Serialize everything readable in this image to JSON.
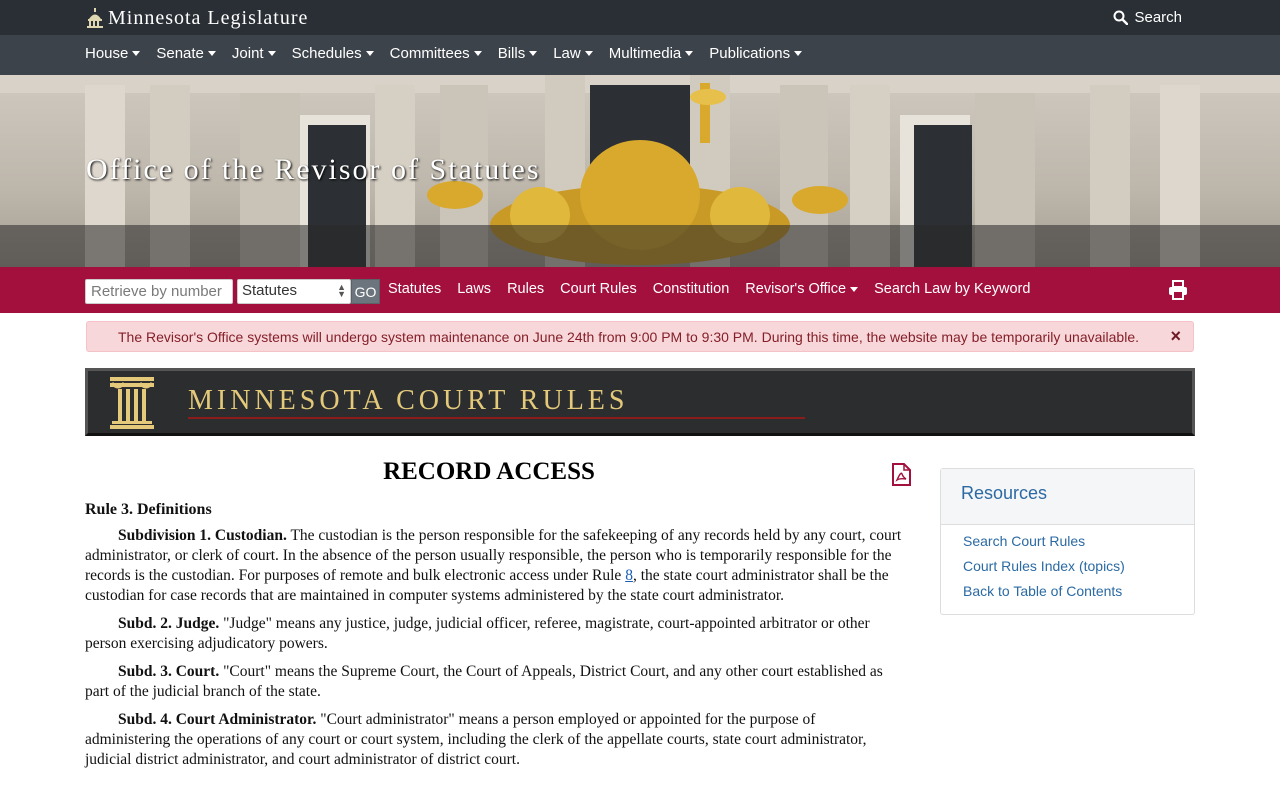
{
  "topbar": {
    "brand": "Minnesota Legislature",
    "search_label": "Search"
  },
  "mainnav": {
    "items": [
      "House",
      "Senate",
      "Joint",
      "Schedules",
      "Committees",
      "Bills",
      "Law",
      "Multimedia",
      "Publications"
    ]
  },
  "hero": {
    "title": "Office of the Revisor of Statutes"
  },
  "rednav": {
    "retrieve_placeholder": "Retrieve by number",
    "select_value": "Statutes",
    "go_label": "GO",
    "links": [
      "Statutes",
      "Laws",
      "Rules",
      "Court Rules",
      "Constitution",
      "Revisor's Office",
      "Search Law by Keyword"
    ]
  },
  "alert": {
    "message": "The Revisor's Office systems will undergo system maintenance on June 24th from 9:00 PM to 9:30 PM. During this time, the website may be temporarily unavailable.",
    "close": "×"
  },
  "banner": {
    "title": "MINNESOTA COURT RULES"
  },
  "document": {
    "title": "RECORD ACCESS",
    "rule_heading": "Rule 3.  Definitions",
    "paragraphs": [
      {
        "label": "Subdivision 1.  Custodian.",
        "text_before_link": " The custodian is the person responsible for the safekeeping of any records held by any court, court administrator, or clerk of court. In the absence of the person usually responsible, the person who is temporarily responsible for the records is the custodian. For purposes of remote and bulk electronic access under Rule ",
        "link": "8",
        "text_after_link": ", the state court administrator shall be the custodian for case records that are maintained in computer systems administered by the state court administrator."
      },
      {
        "label": "Subd. 2.  Judge.",
        "text": " \"Judge\" means any justice, judge, judicial officer, referee, magistrate, court-appointed arbitrator or other person exercising adjudicatory powers."
      },
      {
        "label": "Subd. 3.  Court.",
        "text": " \"Court\" means the Supreme Court, the Court of Appeals, District Court, and any other court established as part of the judicial branch of the state."
      },
      {
        "label": "Subd. 4.  Court Administrator.",
        "text": " \"Court administrator\" means a person employed or appointed for the purpose of administering the operations of any court or court system, including the clerk of the appellate courts, state court administrator, judicial district administrator, and court administrator of district court."
      }
    ]
  },
  "sidebar": {
    "title": "Resources",
    "links": [
      "Search Court Rules",
      "Court Rules Index (topics)",
      "Back to Table of Contents"
    ]
  },
  "colors": {
    "topbar": "#2a2f35",
    "mainnav": "#3d434a",
    "rednav": "#a3103e",
    "banner_gold": "#e3c979",
    "link_blue": "#2b6aa3"
  }
}
